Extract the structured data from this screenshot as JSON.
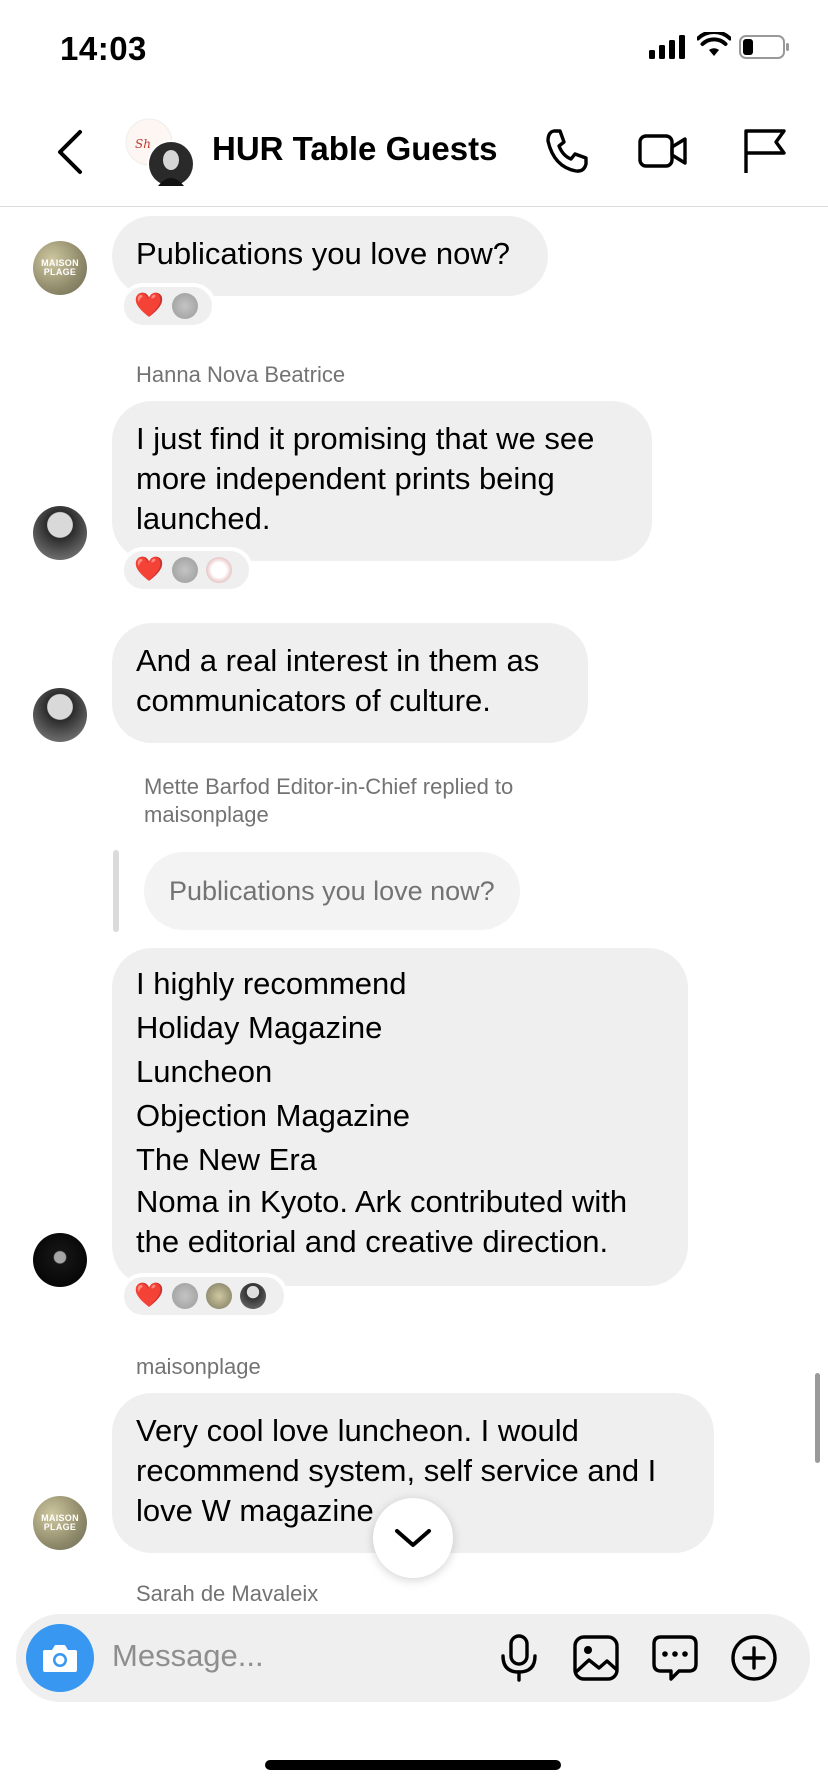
{
  "status_bar": {
    "time": "14:03"
  },
  "header": {
    "title": "HUR Table Guests"
  },
  "messages": [
    {
      "sender": "",
      "text": "Publications you love now?"
    },
    {
      "sender": "Hanna Nova Beatrice",
      "text": "I just find it promising that we see more independent prints being launched."
    },
    {
      "sender": "",
      "text": "And a real interest in them as communicators of culture."
    },
    {
      "reply_note": "Mette Barfod Editor-in-Chief replied to maisonplage",
      "quoted": "Publications you love now?",
      "lines": [
        "I highly recommend",
        "Holiday Magazine",
        "Luncheon",
        "Objection Magazine",
        "The New Era",
        "Noma in Kyoto. Ark contributed with the editorial and creative direction."
      ]
    },
    {
      "sender": "maisonplage",
      "text": "Very cool love luncheon. I would recommend system, self service and I love W magazine"
    },
    {
      "sender": "Sarah de Mavaleix"
    }
  ],
  "avatars": {
    "maison_label_line1": "MAISON",
    "maison_label_line2": "PLAGE"
  },
  "reactions": {
    "heart": "❤️"
  },
  "composer": {
    "placeholder": "Message..."
  },
  "colors": {
    "bubble": "#efefef",
    "accent": "#3897f0",
    "meta_text": "#737373"
  },
  "icons": [
    "back-chevron-icon",
    "phone-icon",
    "video-camera-icon",
    "flag-icon",
    "camera-icon",
    "microphone-icon",
    "gallery-icon",
    "sticker-chat-icon",
    "plus-circle-icon",
    "chevron-down-icon"
  ]
}
